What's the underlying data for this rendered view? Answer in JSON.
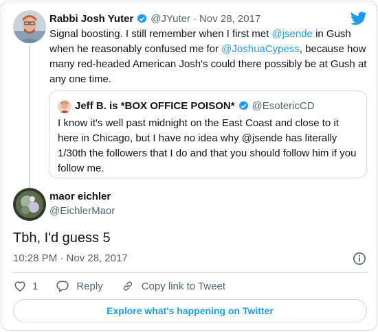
{
  "parent_tweet": {
    "author_name": "Rabbi Josh Yuter",
    "handle": "@JYuter",
    "separator": "·",
    "date": "Nov 28, 2017",
    "text_parts": [
      {
        "text": "Signal boosting. I still remember when I first met ",
        "type": "text"
      },
      {
        "text": "@jsende",
        "type": "mention"
      },
      {
        "text": " in Gush when he reasonably confused me for ",
        "type": "text"
      },
      {
        "text": "@JoshuaCypess",
        "type": "mention"
      },
      {
        "text": ", because how many red-headed American Josh's could there possibly be at Gush at any one time.",
        "type": "text"
      }
    ]
  },
  "quoted_tweet": {
    "author_name": "Jeff B. is *BOX OFFICE POISON*",
    "handle": "@EsotericCD",
    "text": "I know it's well past midnight on the East Coast and close to it here in Chicago, but I have no idea why @jsende has literally 1/30th the followers that I do and that you should follow him if you follow me."
  },
  "main_tweet": {
    "author_name": "maor eichler",
    "handle": "@EichlerMaor",
    "text": "Tbh, I'd guess 5",
    "timestamp": "10:28 PM · Nov 28, 2017"
  },
  "actions": {
    "like_count": "1",
    "reply_label": "Reply",
    "copy_label": "Copy link to Tweet"
  },
  "explore_label": "Explore what's happening on Twitter",
  "icons": [
    "twitter-bird-icon",
    "verified-badge-icon",
    "info-icon",
    "heart-icon",
    "reply-icon",
    "link-icon"
  ],
  "colors": {
    "accent": "#1d9bf0",
    "text": "#0f1419",
    "secondary": "#536471",
    "border": "#cfd9de"
  }
}
